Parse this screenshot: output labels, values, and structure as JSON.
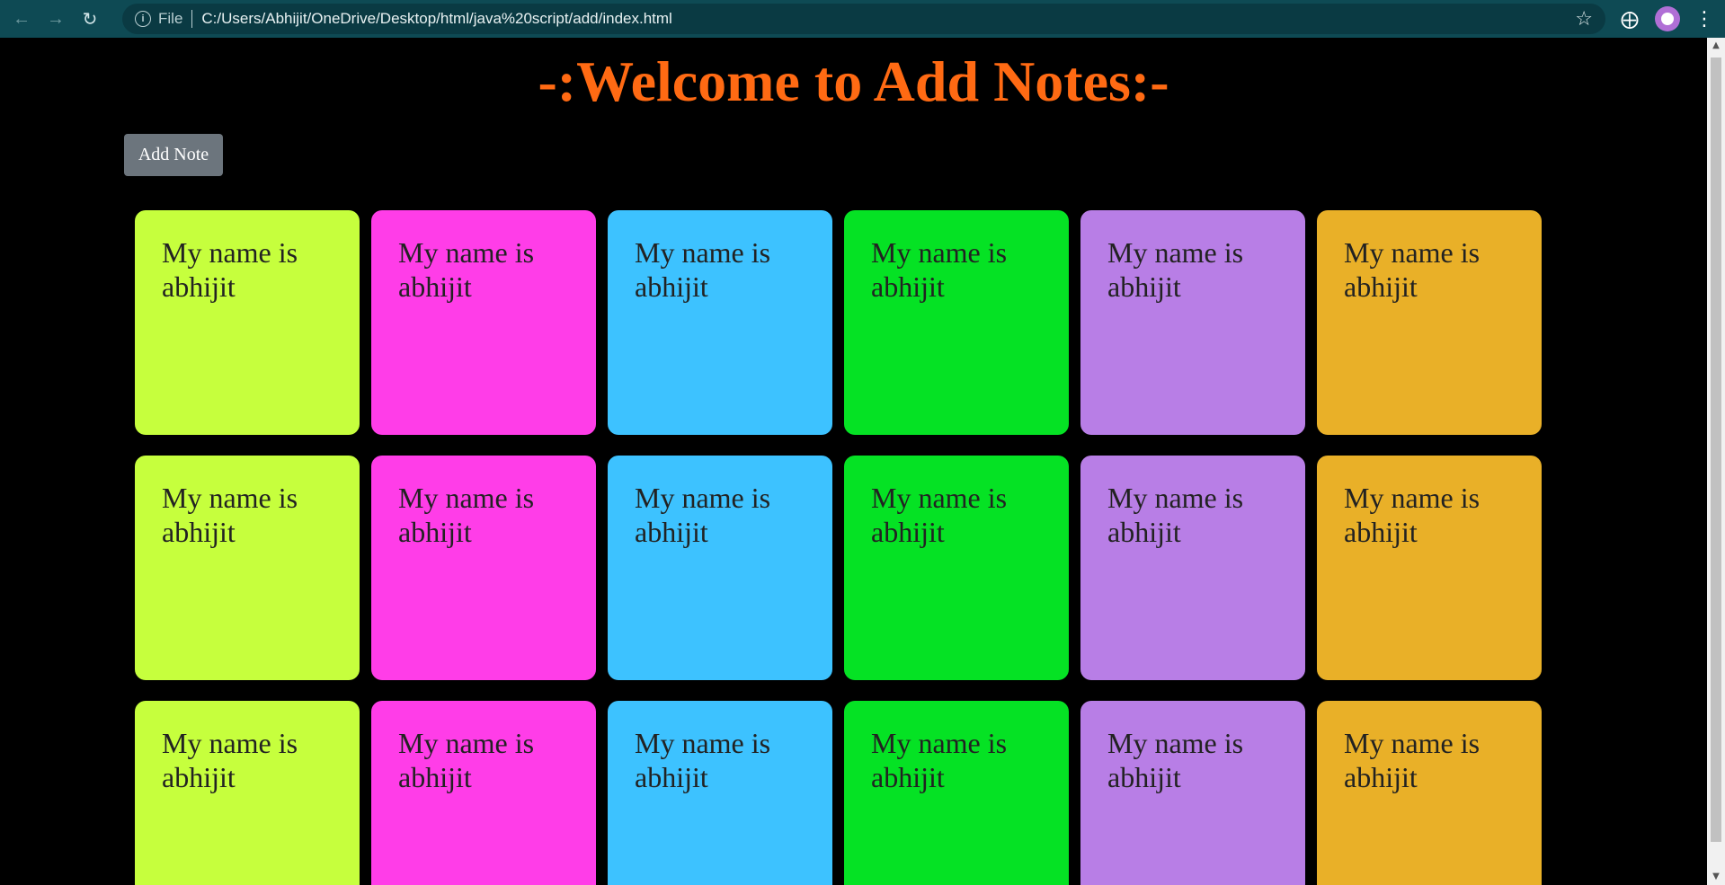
{
  "browser": {
    "scheme_label": "File",
    "url": "C:/Users/Abhijit/OneDrive/Desktop/html/java%20script/add/index.html",
    "icons": [
      "back-icon",
      "forward-icon",
      "reload-icon",
      "info-icon",
      "star-icon",
      "puzzle-icon",
      "profile-avatar",
      "menu-dots-icon"
    ]
  },
  "page": {
    "title": "-:Welcome to Add Notes:-",
    "add_button_label": "Add Note"
  },
  "notes": [
    {
      "text": "My name is abhijit",
      "color": "#c6ff3d"
    },
    {
      "text": "My name is abhijit",
      "color": "#ff3de8"
    },
    {
      "text": "My name is abhijit",
      "color": "#3dc2ff"
    },
    {
      "text": "My name is abhijit",
      "color": "#05e224"
    },
    {
      "text": "My name is abhijit",
      "color": "#b87ee6"
    },
    {
      "text": "My name is abhijit",
      "color": "#e9b028"
    },
    {
      "text": "My name is abhijit",
      "color": "#c6ff3d"
    },
    {
      "text": "My name is abhijit",
      "color": "#ff3de8"
    },
    {
      "text": "My name is abhijit",
      "color": "#3dc2ff"
    },
    {
      "text": "My name is abhijit",
      "color": "#05e224"
    },
    {
      "text": "My name is abhijit",
      "color": "#b87ee6"
    },
    {
      "text": "My name is abhijit",
      "color": "#e9b028"
    },
    {
      "text": "My name is abhijit",
      "color": "#c6ff3d"
    },
    {
      "text": "My name is abhijit",
      "color": "#ff3de8"
    },
    {
      "text": "My name is abhijit",
      "color": "#3dc2ff"
    },
    {
      "text": "My name is abhijit",
      "color": "#05e224"
    },
    {
      "text": "My name is abhijit",
      "color": "#b87ee6"
    },
    {
      "text": "My name is abhijit",
      "color": "#e9b028"
    }
  ],
  "colors": {
    "title": "#ff6a13",
    "background": "#000000",
    "chrome": "#0e4a54",
    "button": "#6c757d"
  }
}
